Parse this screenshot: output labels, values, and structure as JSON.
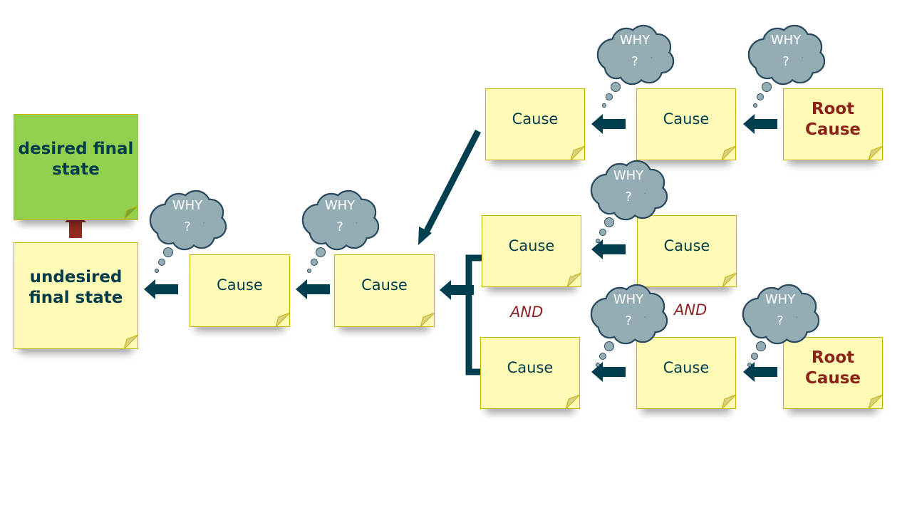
{
  "colors": {
    "arrow": "#003f4f",
    "note": "#fffab6",
    "goal": "#92d050",
    "root": "#8b2318",
    "cloud": "#94adb4"
  },
  "notes": {
    "desired": "desired final state",
    "undesired": "undesired final state",
    "cause": "Cause",
    "root": "Root Cause"
  },
  "cloud": {
    "line1": "WHY",
    "line2": "?"
  },
  "and_label": "AND"
}
